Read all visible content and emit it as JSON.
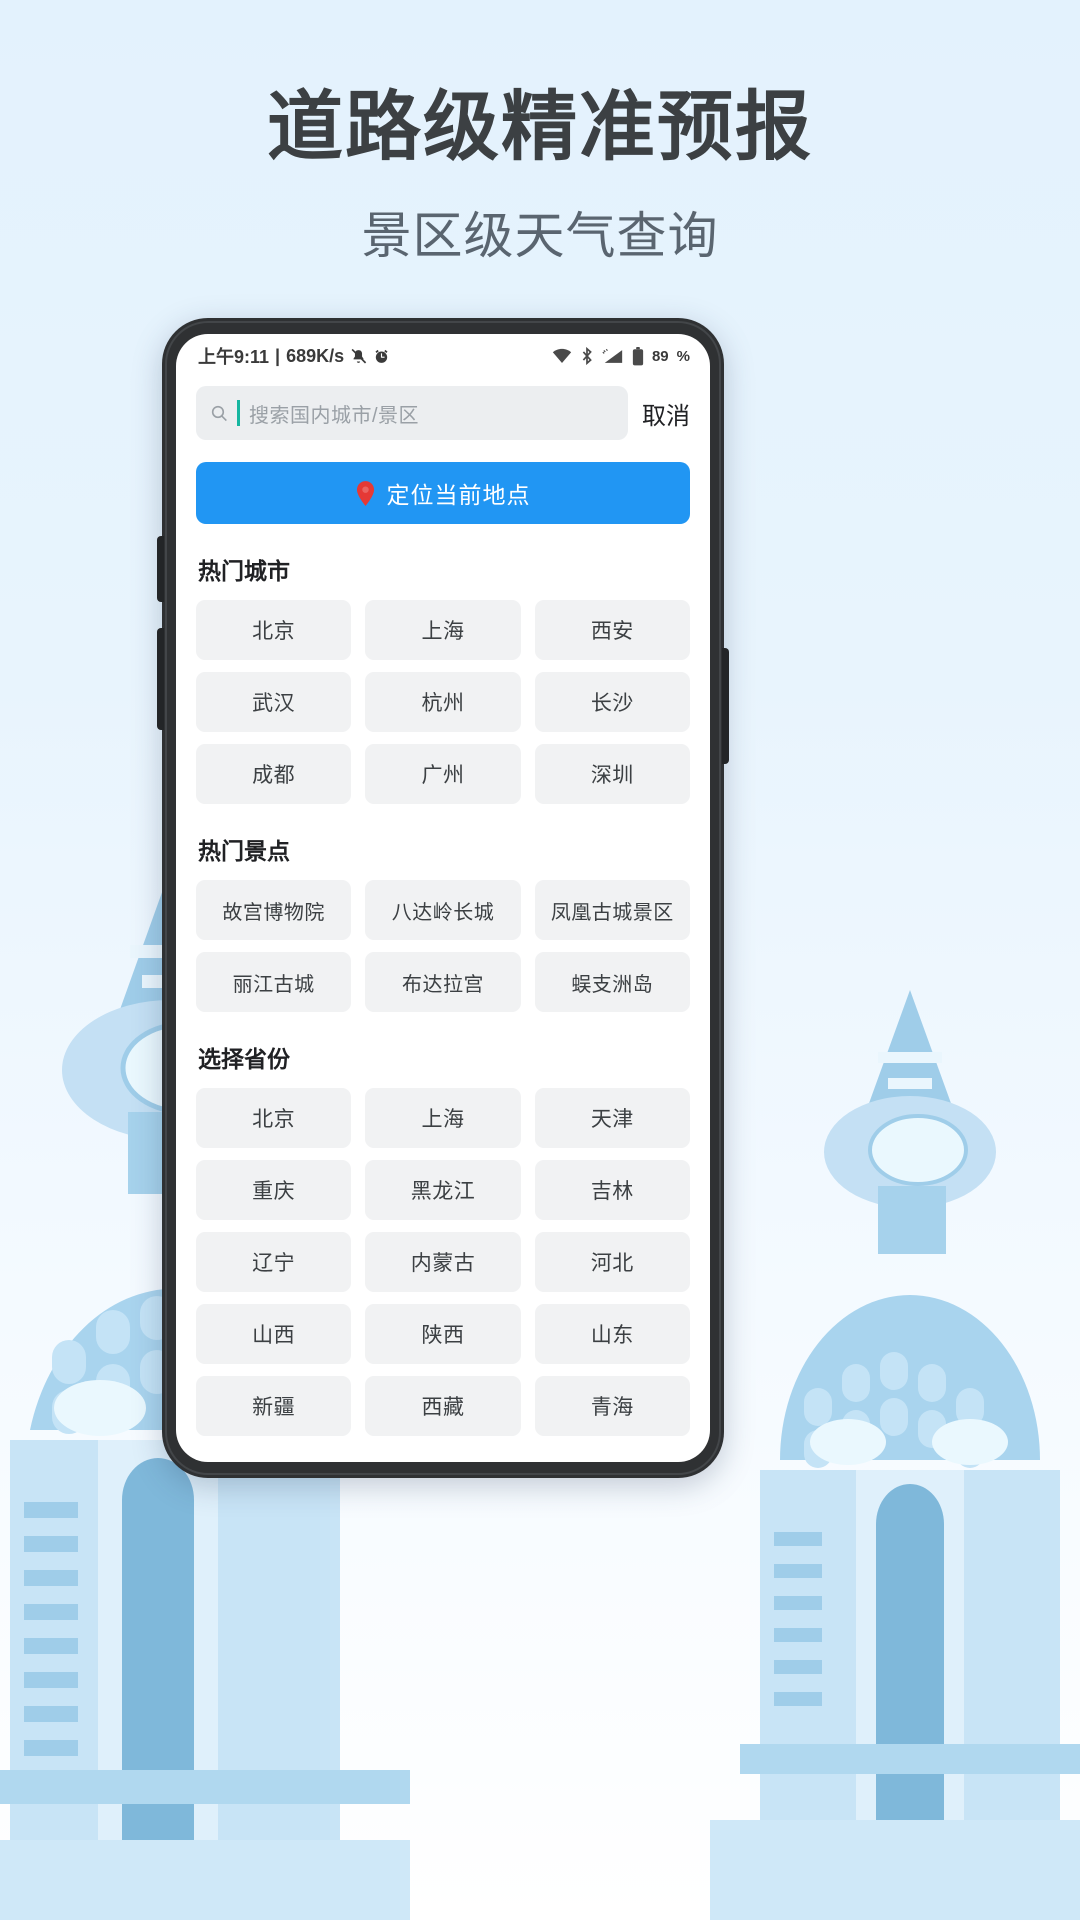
{
  "headline": {
    "title": "道路级精准预报",
    "subtitle": "景区级天气查询"
  },
  "colors": {
    "page_bg_top": "#e3f2fd",
    "accent_blue": "#2196f3",
    "pin_red": "#e53935",
    "caret_teal": "#16b6a0",
    "chip_bg": "#f1f2f3"
  },
  "statusbar": {
    "time": "上午9:11",
    "separator": "|",
    "netspeed": "689K/s",
    "left_icons": [
      "mute-icon",
      "alarm-icon"
    ],
    "right_icons": [
      "wifi-icon",
      "bluetooth-icon",
      "signal-icon",
      "battery-icon"
    ],
    "battery_level": "89",
    "battery_unit": "%"
  },
  "search": {
    "icon": "search-icon",
    "placeholder": "搜索国内城市/景区",
    "value": "",
    "cancel_label": "取消"
  },
  "locate": {
    "icon": "location-pin-icon",
    "label": "定位当前地点"
  },
  "sections": [
    {
      "id": "hot-cities",
      "title": "热门城市",
      "items": [
        "北京",
        "上海",
        "西安",
        "武汉",
        "杭州",
        "长沙",
        "成都",
        "广州",
        "深圳"
      ]
    },
    {
      "id": "hot-spots",
      "title": "热门景点",
      "items": [
        "故宫博物院",
        "八达岭长城",
        "凤凰古城景区",
        "丽江古城",
        "布达拉宫",
        "蜈支洲岛"
      ]
    },
    {
      "id": "provinces",
      "title": "选择省份",
      "items": [
        "北京",
        "上海",
        "天津",
        "重庆",
        "黑龙江",
        "吉林",
        "辽宁",
        "内蒙古",
        "河北",
        "山西",
        "陕西",
        "山东",
        "新疆",
        "西藏",
        "青海"
      ]
    }
  ]
}
